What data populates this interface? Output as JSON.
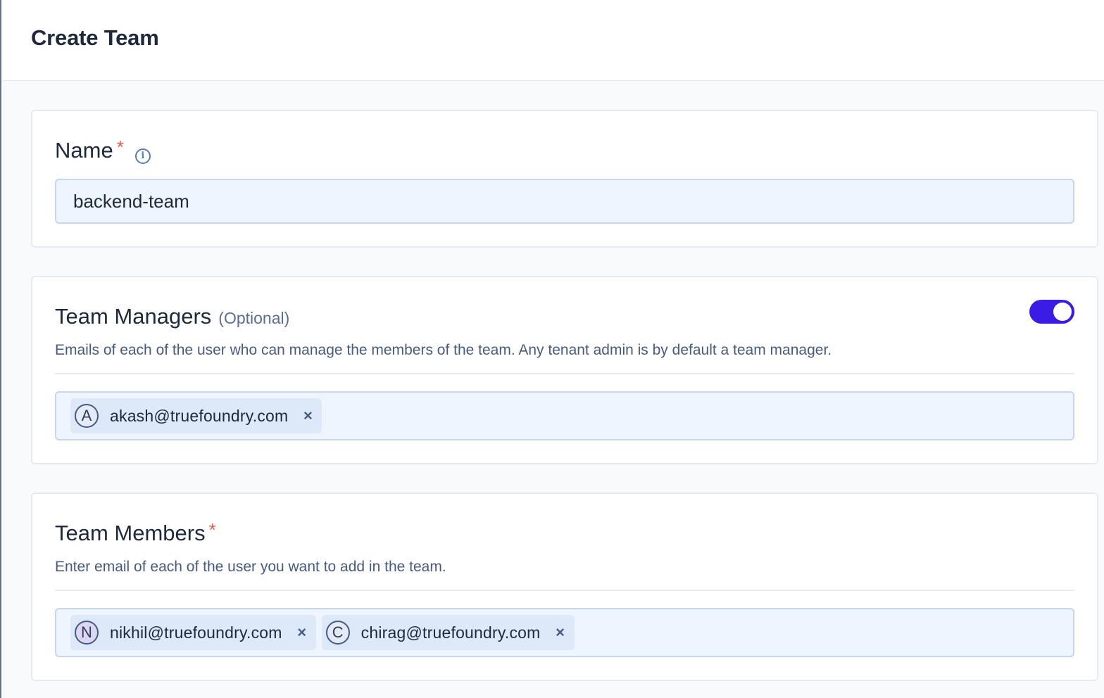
{
  "header": {
    "title": "Create Team"
  },
  "name_section": {
    "label": "Name",
    "required_mark": "*",
    "info_icon": "info-icon",
    "value": "backend-team"
  },
  "managers_section": {
    "label": "Team Managers",
    "optional": "(Optional)",
    "toggle_on": true,
    "description": "Emails of each of the user who can manage the members of the team. Any tenant admin is by default a team manager.",
    "chips": [
      {
        "initial": "A",
        "email": "akash@truefoundry.com",
        "remove": "×"
      }
    ]
  },
  "members_section": {
    "label": "Team Members",
    "required_mark": "*",
    "description": "Enter email of each of the user you want to add in the team.",
    "chips": [
      {
        "initial": "N",
        "email": "nikhil@truefoundry.com",
        "remove": "×"
      },
      {
        "initial": "C",
        "email": "chirag@truefoundry.com",
        "remove": "×"
      }
    ]
  },
  "colors": {
    "accent": "#3b1be6",
    "required": "#e0604a",
    "input_bg": "#eef5ff",
    "chip_bg": "#dde8f8"
  }
}
